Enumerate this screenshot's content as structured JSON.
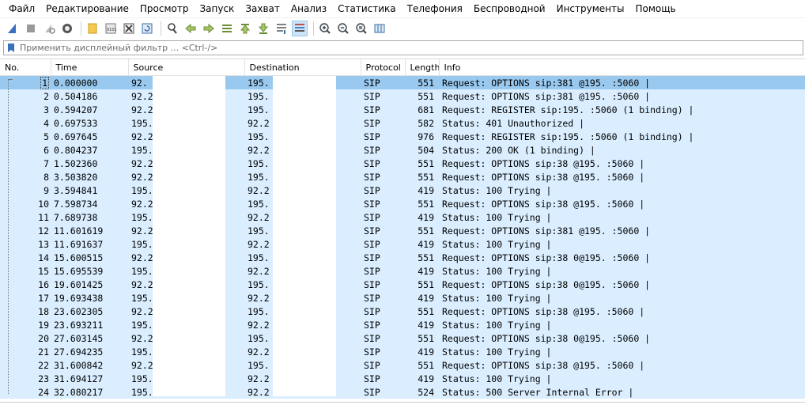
{
  "menu": [
    "Файл",
    "Редактирование",
    "Просмотр",
    "Запуск",
    "Захват",
    "Анализ",
    "Статистика",
    "Телефония",
    "Беспроводной",
    "Инструменты",
    "Помощь"
  ],
  "toolbar_icons": [
    "shark-fin-start-icon",
    "stop-icon",
    "restart-icon",
    "capture-options-icon",
    "open-file-icon",
    "save-file-icon",
    "close-file-icon",
    "reload-icon",
    "find-icon",
    "back-icon",
    "forward-icon",
    "go-to-packet-icon",
    "first-packet-icon",
    "last-packet-icon",
    "autoscroll-icon",
    "colorize-icon",
    "zoom-in-icon",
    "zoom-out-icon",
    "zoom-reset-icon",
    "resize-columns-icon"
  ],
  "filter": {
    "placeholder": "Применить дисплейный фильтр ... <Ctrl-/>",
    "value": ""
  },
  "columns": [
    "No.",
    "Time",
    "Source",
    "Destination",
    "Protocol",
    "Length",
    "Info"
  ],
  "colors": {
    "row": "#daeeff",
    "selected": "#99c9ef"
  },
  "packets": [
    {
      "no": "1",
      "time": "0.000000",
      "src": "92.",
      "dst": "195.",
      "proto": "SIP",
      "len": "551",
      "info": "Request: OPTIONS sip:381                @195.                 :5060  |"
    },
    {
      "no": "2",
      "time": "0.504186",
      "src": "92.2",
      "dst": "195.",
      "proto": "SIP",
      "len": "551",
      "info": "Request: OPTIONS sip:381       @195.                 :5060  |"
    },
    {
      "no": "3",
      "time": "0.594207",
      "src": "92.2",
      "dst": "195.",
      "proto": "SIP",
      "len": "681",
      "info": "Request: REGISTER sip:195.              :5060  (1 binding)  |"
    },
    {
      "no": "4",
      "time": "0.697533",
      "src": "195.",
      "dst": "92.2",
      "proto": "SIP",
      "len": "582",
      "info": "Status: 401 Unauthorized  |"
    },
    {
      "no": "5",
      "time": "0.697645",
      "src": "92.2",
      "dst": "195.",
      "proto": "SIP",
      "len": "976",
      "info": "Request: REGISTER sip:195.              :5060  (1 binding)  |"
    },
    {
      "no": "6",
      "time": "0.804237",
      "src": "195.",
      "dst": "92.2",
      "proto": "SIP",
      "len": "504",
      "info": "Status: 200 OK  (1 binding)  |"
    },
    {
      "no": "7",
      "time": "1.502360",
      "src": "92.2",
      "dst": "195.",
      "proto": "SIP",
      "len": "551",
      "info": "Request: OPTIONS sip:38         @195.                 :5060  |"
    },
    {
      "no": "8",
      "time": "3.503820",
      "src": "92.2",
      "dst": "195.",
      "proto": "SIP",
      "len": "551",
      "info": "Request: OPTIONS sip:38         @195.                 :5060  |"
    },
    {
      "no": "9",
      "time": "3.594841",
      "src": "195.",
      "dst": "92.2",
      "proto": "SIP",
      "len": "419",
      "info": "Status: 100 Trying  |"
    },
    {
      "no": "10",
      "time": "7.598734",
      "src": "92.2",
      "dst": "195.",
      "proto": "SIP",
      "len": "551",
      "info": "Request: OPTIONS sip:38         @195.                 :5060  |"
    },
    {
      "no": "11",
      "time": "7.689738",
      "src": "195.",
      "dst": "92.2",
      "proto": "SIP",
      "len": "419",
      "info": "Status: 100 Trying  |"
    },
    {
      "no": "12",
      "time": "11.601619",
      "src": "92.2",
      "dst": "195.",
      "proto": "SIP",
      "len": "551",
      "info": "Request: OPTIONS sip:381       @195.                 :5060  |"
    },
    {
      "no": "13",
      "time": "11.691637",
      "src": "195.",
      "dst": "92.2",
      "proto": "SIP",
      "len": "419",
      "info": "Status: 100 Trying  |"
    },
    {
      "no": "14",
      "time": "15.600515",
      "src": "92.2",
      "dst": "195.",
      "proto": "SIP",
      "len": "551",
      "info": "Request: OPTIONS sip:38         0@195.                :5060  |"
    },
    {
      "no": "15",
      "time": "15.695539",
      "src": "195.",
      "dst": "92.2",
      "proto": "SIP",
      "len": "419",
      "info": "Status: 100 Trying  |"
    },
    {
      "no": "16",
      "time": "19.601425",
      "src": "92.2",
      "dst": "195.",
      "proto": "SIP",
      "len": "551",
      "info": "Request: OPTIONS sip:38         0@195.                :5060  |"
    },
    {
      "no": "17",
      "time": "19.693438",
      "src": "195.",
      "dst": "92.2",
      "proto": "SIP",
      "len": "419",
      "info": "Status: 100 Trying  |"
    },
    {
      "no": "18",
      "time": "23.602305",
      "src": "92.2",
      "dst": "195.",
      "proto": "SIP",
      "len": "551",
      "info": "Request: OPTIONS sip:38         @195.                 :5060  |"
    },
    {
      "no": "19",
      "time": "23.693211",
      "src": "195.",
      "dst": "92.2",
      "proto": "SIP",
      "len": "419",
      "info": "Status: 100 Trying  |"
    },
    {
      "no": "20",
      "time": "27.603145",
      "src": "92.2",
      "dst": "195.",
      "proto": "SIP",
      "len": "551",
      "info": "Request: OPTIONS sip:38         0@195.                :5060  |"
    },
    {
      "no": "21",
      "time": "27.694235",
      "src": "195.",
      "dst": "92.2",
      "proto": "SIP",
      "len": "419",
      "info": "Status: 100 Trying  |"
    },
    {
      "no": "22",
      "time": "31.600842",
      "src": "92.2",
      "dst": "195.",
      "proto": "SIP",
      "len": "551",
      "info": "Request: OPTIONS sip:38         @195.                 :5060  |"
    },
    {
      "no": "23",
      "time": "31.694127",
      "src": "195.",
      "dst": "92.2",
      "proto": "SIP",
      "len": "419",
      "info": "Status: 100 Trying  |"
    },
    {
      "no": "24",
      "time": "32.080217",
      "src": "195.",
      "dst": "92.2",
      "proto": "SIP",
      "len": "524",
      "info": "Status: 500 Server Internal Error  |"
    }
  ]
}
